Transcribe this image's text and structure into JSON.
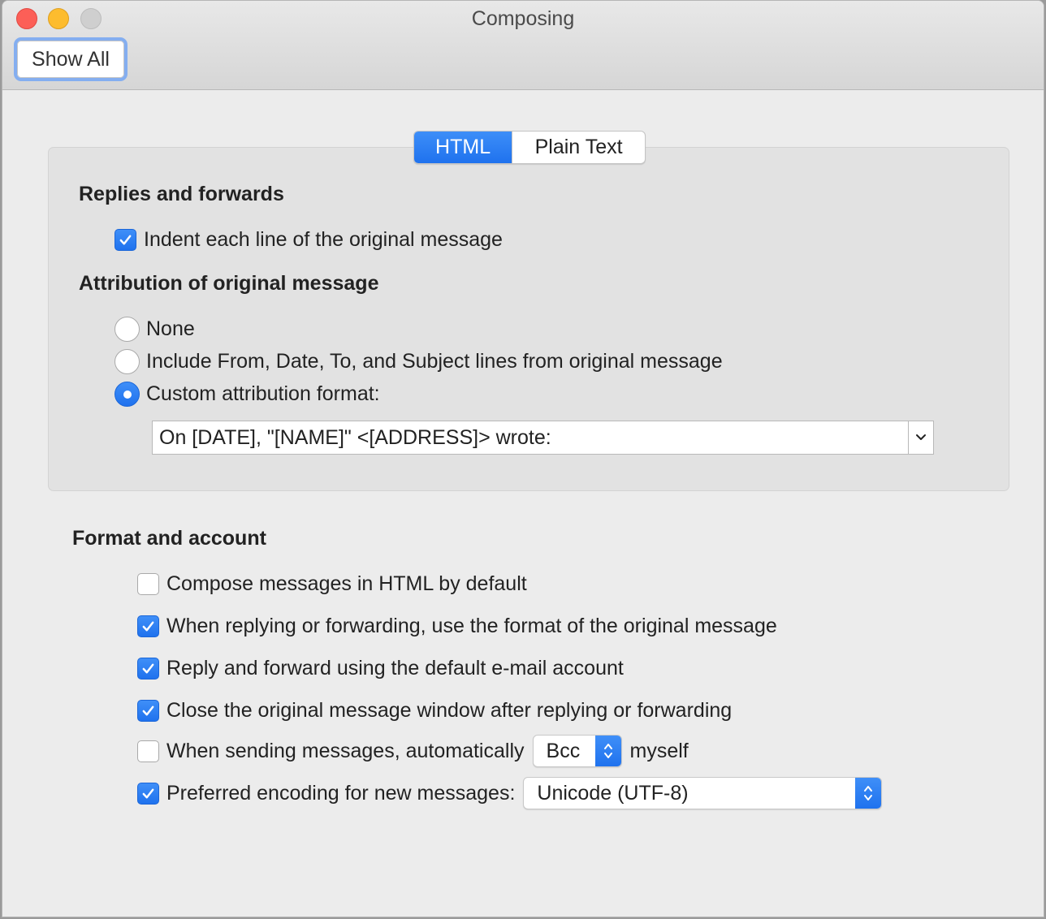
{
  "window": {
    "title": "Composing",
    "show_all_label": "Show All"
  },
  "tabs": [
    {
      "label": "HTML",
      "active": true
    },
    {
      "label": "Plain Text",
      "active": false
    }
  ],
  "replies": {
    "heading": "Replies and forwards",
    "indent_label": "Indent each line of the original message",
    "indent_checked": true
  },
  "attribution": {
    "heading": "Attribution of original message",
    "options": [
      {
        "label": "None",
        "selected": false
      },
      {
        "label": "Include From, Date, To, and Subject lines from original message",
        "selected": false
      },
      {
        "label": "Custom attribution format:",
        "selected": true
      }
    ],
    "custom_format_value": "On [DATE], \"[NAME]\" <[ADDRESS]> wrote:"
  },
  "format_account": {
    "heading": "Format and account",
    "items": [
      {
        "label": "Compose messages in HTML by default",
        "checked": false
      },
      {
        "label": "When replying or forwarding, use the format of the original message",
        "checked": true
      },
      {
        "label": "Reply and forward using the default e-mail account",
        "checked": true
      },
      {
        "label": "Close the original message window after replying or forwarding",
        "checked": true
      }
    ],
    "auto_send": {
      "label": "When sending messages, automatically",
      "checked": false,
      "select_value": "Bcc",
      "suffix": "myself"
    },
    "encoding": {
      "label": "Preferred encoding for new messages:",
      "checked": true,
      "select_value": "Unicode (UTF-8)"
    }
  },
  "colors": {
    "accent": "#1f72ee",
    "focus_ring": "#84aef0"
  }
}
